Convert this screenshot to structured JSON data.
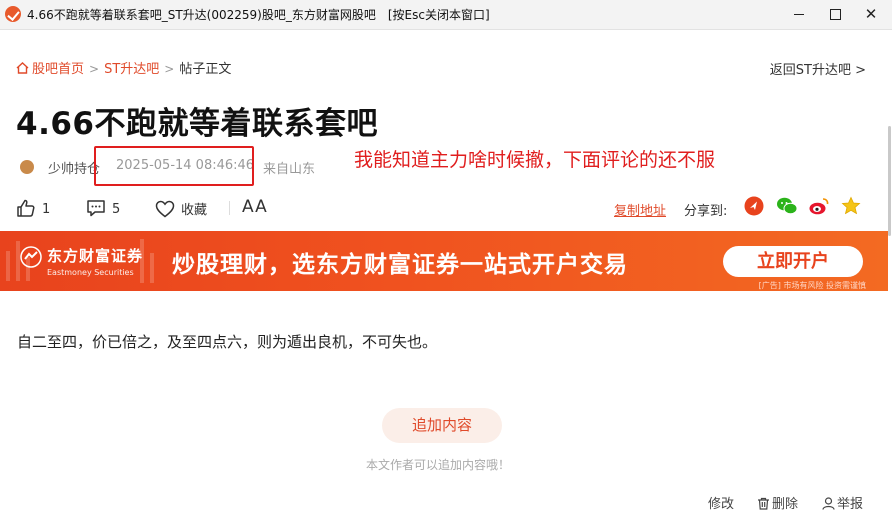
{
  "window": {
    "title": "4.66不跑就等着联系套吧_ST升达(002259)股吧_东方财富网股吧　[按Esc关闭本窗口]",
    "minimize": "—",
    "maximize": "☐",
    "close": "✕"
  },
  "breadcrumb": {
    "items": [
      "股吧首页",
      "ST升达吧",
      "帖子正文"
    ],
    "separator": ">",
    "back_link": "返回ST升达吧 >"
  },
  "post": {
    "title": "4.66不跑就等着联系套吧",
    "author": "少帅持仓",
    "time": "2025-05-14 08:46:46",
    "from": "来自山东",
    "body": "自二至四，价已倍之，及至四点六，则为遁出良机，不可失也。"
  },
  "annotation": {
    "text": "我能知道主力啥时候撤，下面评论的还不服",
    "color": "#e01e1e"
  },
  "actions": {
    "like_count": "1",
    "comment_count": "5",
    "favorite_label": "收藏",
    "font_label": "AA",
    "copy_link": "复制地址",
    "share_label": "分享到:"
  },
  "share_icons": [
    "toutiao-icon",
    "wechat-icon",
    "weibo-icon",
    "star-icon"
  ],
  "banner": {
    "logo_cn": "东方财富证券",
    "logo_en": "Eastmoney Securities",
    "slogan": "炒股理财，选东方财富证券一站式开户交易",
    "button": "立即开户",
    "disclaimer": "[广告] 市场有风险 投资需谨慎",
    "color": "#e8431d"
  },
  "append": {
    "button": "追加内容",
    "hint": "本文作者可以追加内容哦！"
  },
  "bottom": {
    "edit": "修改",
    "delete": "删除",
    "report": "举报"
  },
  "colors": {
    "accent": "#e04a2a",
    "text": "#222222"
  }
}
